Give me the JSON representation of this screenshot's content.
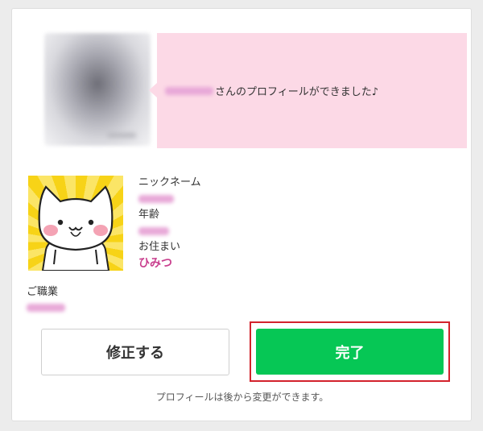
{
  "message": {
    "suffix": "さんのプロフィールができました♪"
  },
  "profile": {
    "nickname_label": "ニックネーム",
    "age_label": "年齢",
    "residence_label": "お住まい",
    "residence_value": "ひみつ",
    "occupation_label": "ご職業"
  },
  "actions": {
    "edit_label": "修正する",
    "done_label": "完了"
  },
  "footer": {
    "note": "プロフィールは後から変更ができます。"
  },
  "colors": {
    "bubble_bg": "#fcd9e6",
    "accent_pink": "#c93f8e",
    "done_green": "#06c755",
    "highlight_red": "#d3222c"
  },
  "icons": {
    "avatar": "cat-character-icon"
  }
}
